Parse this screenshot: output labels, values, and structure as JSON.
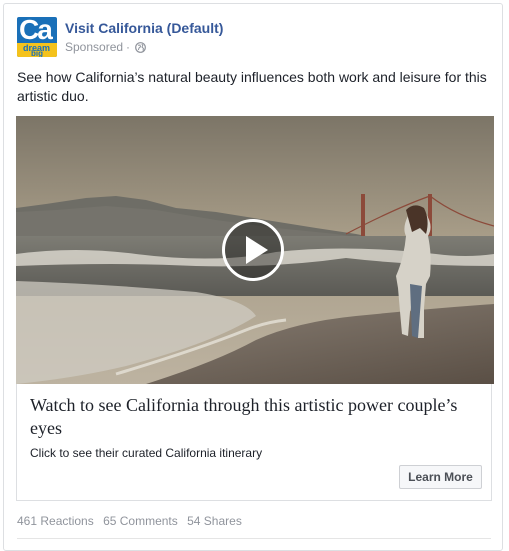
{
  "post": {
    "page_name": "Visit California (Default)",
    "sponsored_label": "Sponsored",
    "separator": "·",
    "privacy_icon": "globe-icon",
    "avatar": {
      "logo_text": "Ca",
      "logo_sub1": "dream",
      "logo_sub2": "big",
      "colors": {
        "primary": "#1a70b8",
        "band": "#f4c21c"
      }
    },
    "body_text": "See how California’s natural beauty influences both work and leisure for this artistic duo.",
    "media": {
      "type": "video",
      "play_icon": "play-icon"
    },
    "link": {
      "headline": "Watch to see California through this artistic power couple’s eyes",
      "description": "Click to see their curated California itinerary",
      "cta_label": "Learn More"
    },
    "stats": {
      "reactions": "461 Reactions",
      "comments": "65 Comments",
      "shares": "54 Shares"
    },
    "colors": {
      "link_blue": "#365899",
      "meta_gray": "#90949c",
      "text": "#1d2129",
      "border": "#dddfe2"
    }
  }
}
